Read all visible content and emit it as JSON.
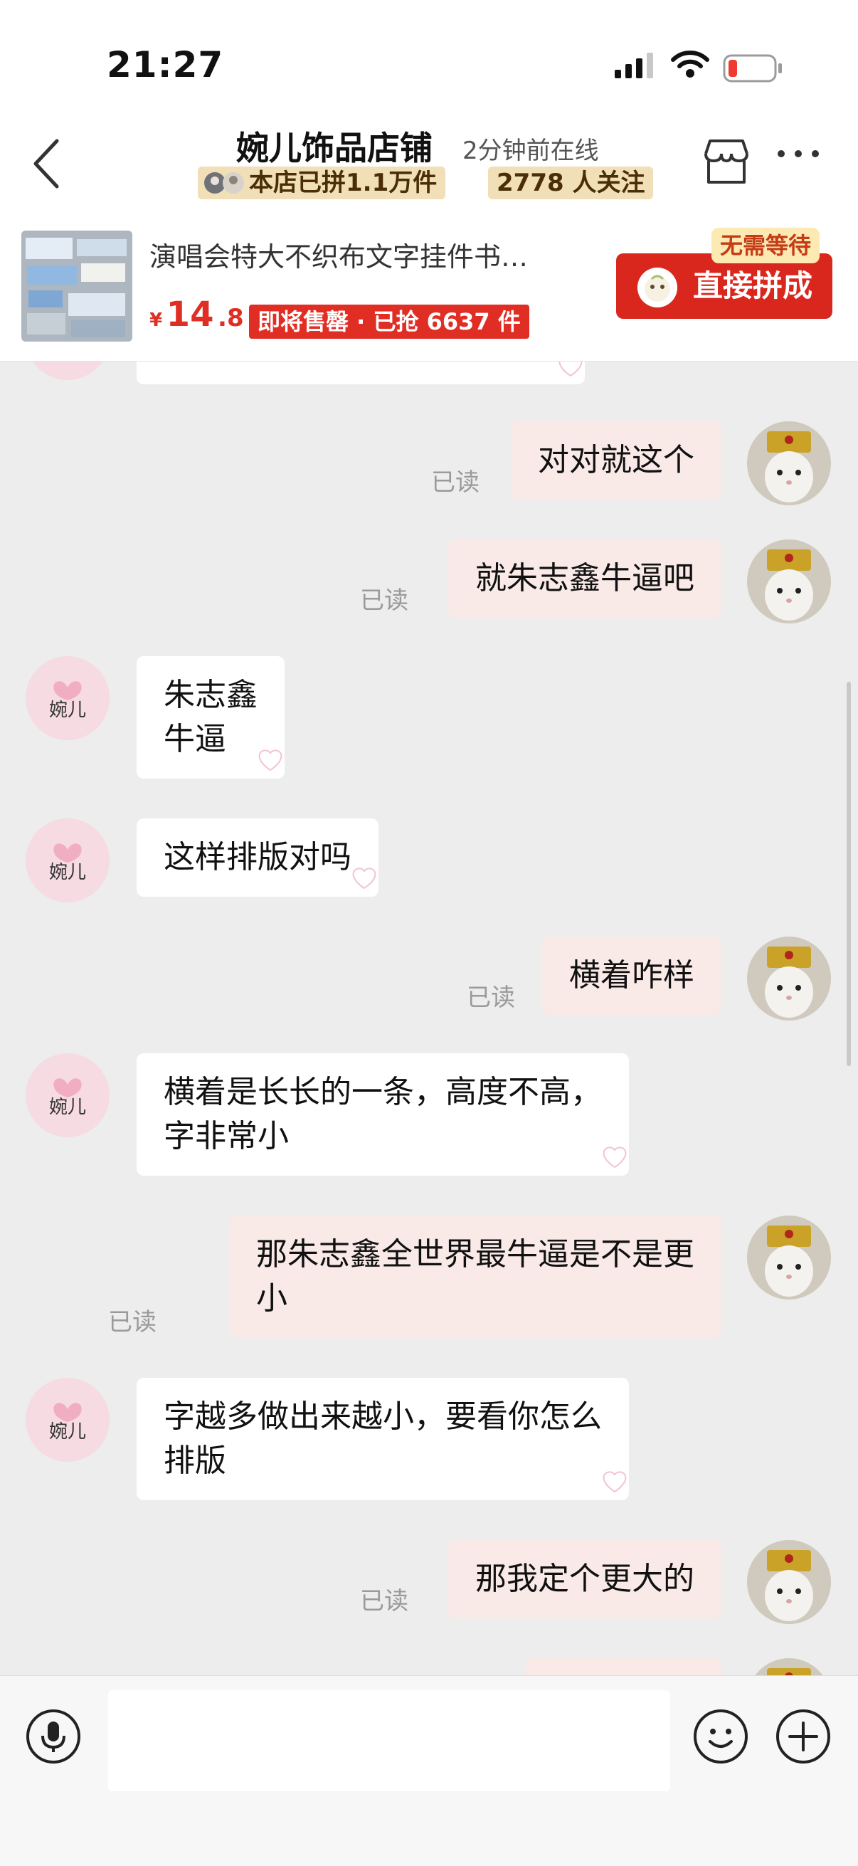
{
  "status_bar": {
    "time": "21:27"
  },
  "header": {
    "shop_name": "婉儿饰品店铺",
    "online_status": "2分钟前在线",
    "group_badge": "本店已拼1.1万件",
    "follow_badge": "2778 人关注"
  },
  "product": {
    "title": "演唱会特大不织布文字挂件书…",
    "currency": "¥",
    "price_int": "14",
    "price_dec": ".8",
    "sale_badge": "即将售罄 · 已抢 6637 件",
    "no_wait_tag": "无需等待",
    "buy_button": "直接拼成"
  },
  "seller_avatar_text": "婉儿",
  "messages": [
    {
      "from": "me",
      "text": "对对就这个",
      "read": "已读"
    },
    {
      "from": "me",
      "text": "就朱志鑫牛逼吧",
      "read": "已读"
    },
    {
      "from": "seller",
      "text": "朱志鑫\n牛逼"
    },
    {
      "from": "seller",
      "text": "这样排版对吗"
    },
    {
      "from": "me",
      "text": "横着咋样",
      "read": "已读"
    },
    {
      "from": "seller",
      "text": "横着是长长的一条，高度不高，\n字非常小"
    },
    {
      "from": "me",
      "text": "那朱志鑫全世界最牛逼是不是更\n小",
      "read": "已读"
    },
    {
      "from": "seller",
      "text": "字越多做出来越小，要看你怎么\n排版"
    },
    {
      "from": "me",
      "text": "那我定个更大的",
      "read": "已读"
    }
  ],
  "input": {
    "placeholder": "",
    "value": ""
  },
  "colors": {
    "brand_red": "#d9271e",
    "price_red": "#e02e24",
    "badge_gold": "#f1dfb8",
    "outgoing_bubble": "#f9eae8",
    "chat_background": "#ededed"
  },
  "icons": [
    "back-icon",
    "store-icon",
    "more-icon",
    "mic-icon",
    "emoji-icon",
    "plus-icon",
    "signal-icon",
    "wifi-icon",
    "battery-icon"
  ]
}
